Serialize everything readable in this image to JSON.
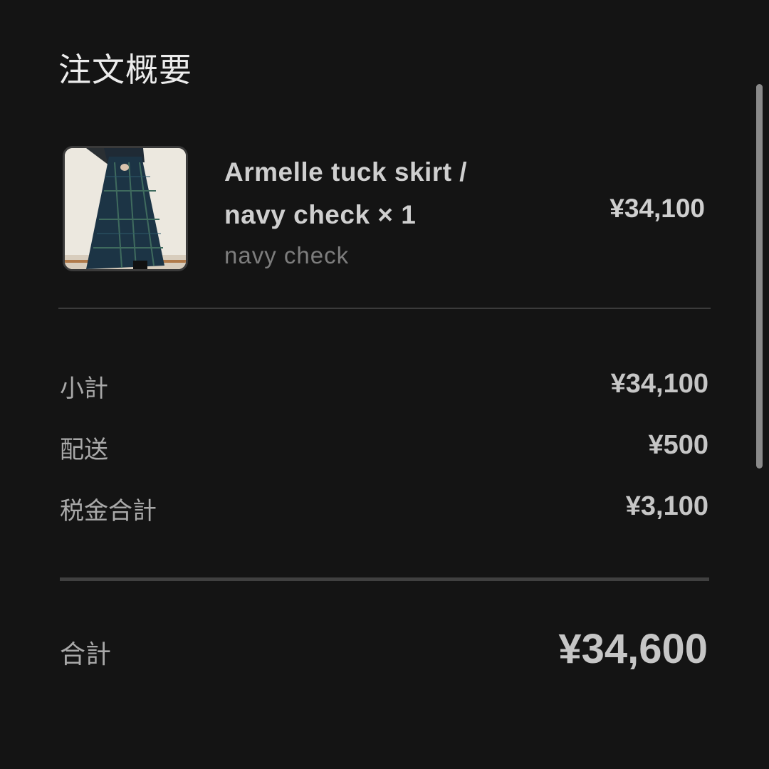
{
  "summary": {
    "title": "注文概要"
  },
  "line_item": {
    "name_line1": "Armelle tuck skirt /",
    "name_line2": "navy check × 1",
    "variant": "navy check",
    "price": "¥34,100",
    "image_icon": "product-thumbnail"
  },
  "totals": {
    "rows": [
      {
        "label": "小計",
        "value": "¥34,100"
      },
      {
        "label": "配送",
        "value": "¥500"
      },
      {
        "label": "税金合計",
        "value": "¥3,100"
      }
    ],
    "total_label": "合計",
    "total_value": "¥34,600"
  },
  "colors": {
    "background": "#141414",
    "text_primary": "#cfcfcf",
    "text_secondary": "#7d7d7d"
  }
}
